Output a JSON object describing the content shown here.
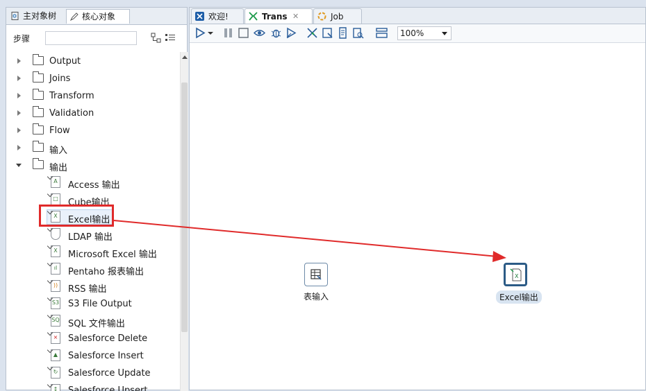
{
  "left_tabs": [
    {
      "label": "主对象树"
    },
    {
      "label": "核心对象"
    }
  ],
  "search": {
    "label": "步骤",
    "placeholder": ""
  },
  "tree": {
    "folders": [
      {
        "label": "Output"
      },
      {
        "label": "Joins"
      },
      {
        "label": "Transform"
      },
      {
        "label": "Validation"
      },
      {
        "label": "Flow"
      },
      {
        "label": "输入"
      },
      {
        "label": "输出"
      }
    ],
    "output_steps": [
      {
        "label": "Access 输出",
        "icon": "access-output-icon"
      },
      {
        "label": "Cube输出",
        "icon": "cube-output-icon"
      },
      {
        "label": "Excel输出",
        "icon": "excel-output-icon"
      },
      {
        "label": "LDAP 输出",
        "icon": "ldap-output-icon"
      },
      {
        "label": "Microsoft Excel 输出",
        "icon": "ms-excel-output-icon"
      },
      {
        "label": "Pentaho 报表输出",
        "icon": "report-output-icon"
      },
      {
        "label": "RSS 输出",
        "icon": "rss-output-icon"
      },
      {
        "label": "S3 File Output",
        "icon": "s3-output-icon"
      },
      {
        "label": "SQL 文件输出",
        "icon": "sql-output-icon"
      },
      {
        "label": "Salesforce Delete",
        "icon": "salesforce-delete-icon"
      },
      {
        "label": "Salesforce Insert",
        "icon": "salesforce-insert-icon"
      },
      {
        "label": "Salesforce Update",
        "icon": "salesforce-update-icon"
      },
      {
        "label": "Salesforce Upsert",
        "icon": "salesforce-upsert-icon"
      }
    ]
  },
  "editor_tabs": [
    {
      "label": "欢迎!"
    },
    {
      "label": "Trans"
    },
    {
      "label": "Job"
    }
  ],
  "toolbar": {
    "zoom": "100%"
  },
  "canvas": {
    "nodes": [
      {
        "label": "表输入"
      },
      {
        "label": "Excel输出"
      }
    ]
  },
  "colors": {
    "highlight": "#e02a2a",
    "accent": "#2c5b86"
  }
}
